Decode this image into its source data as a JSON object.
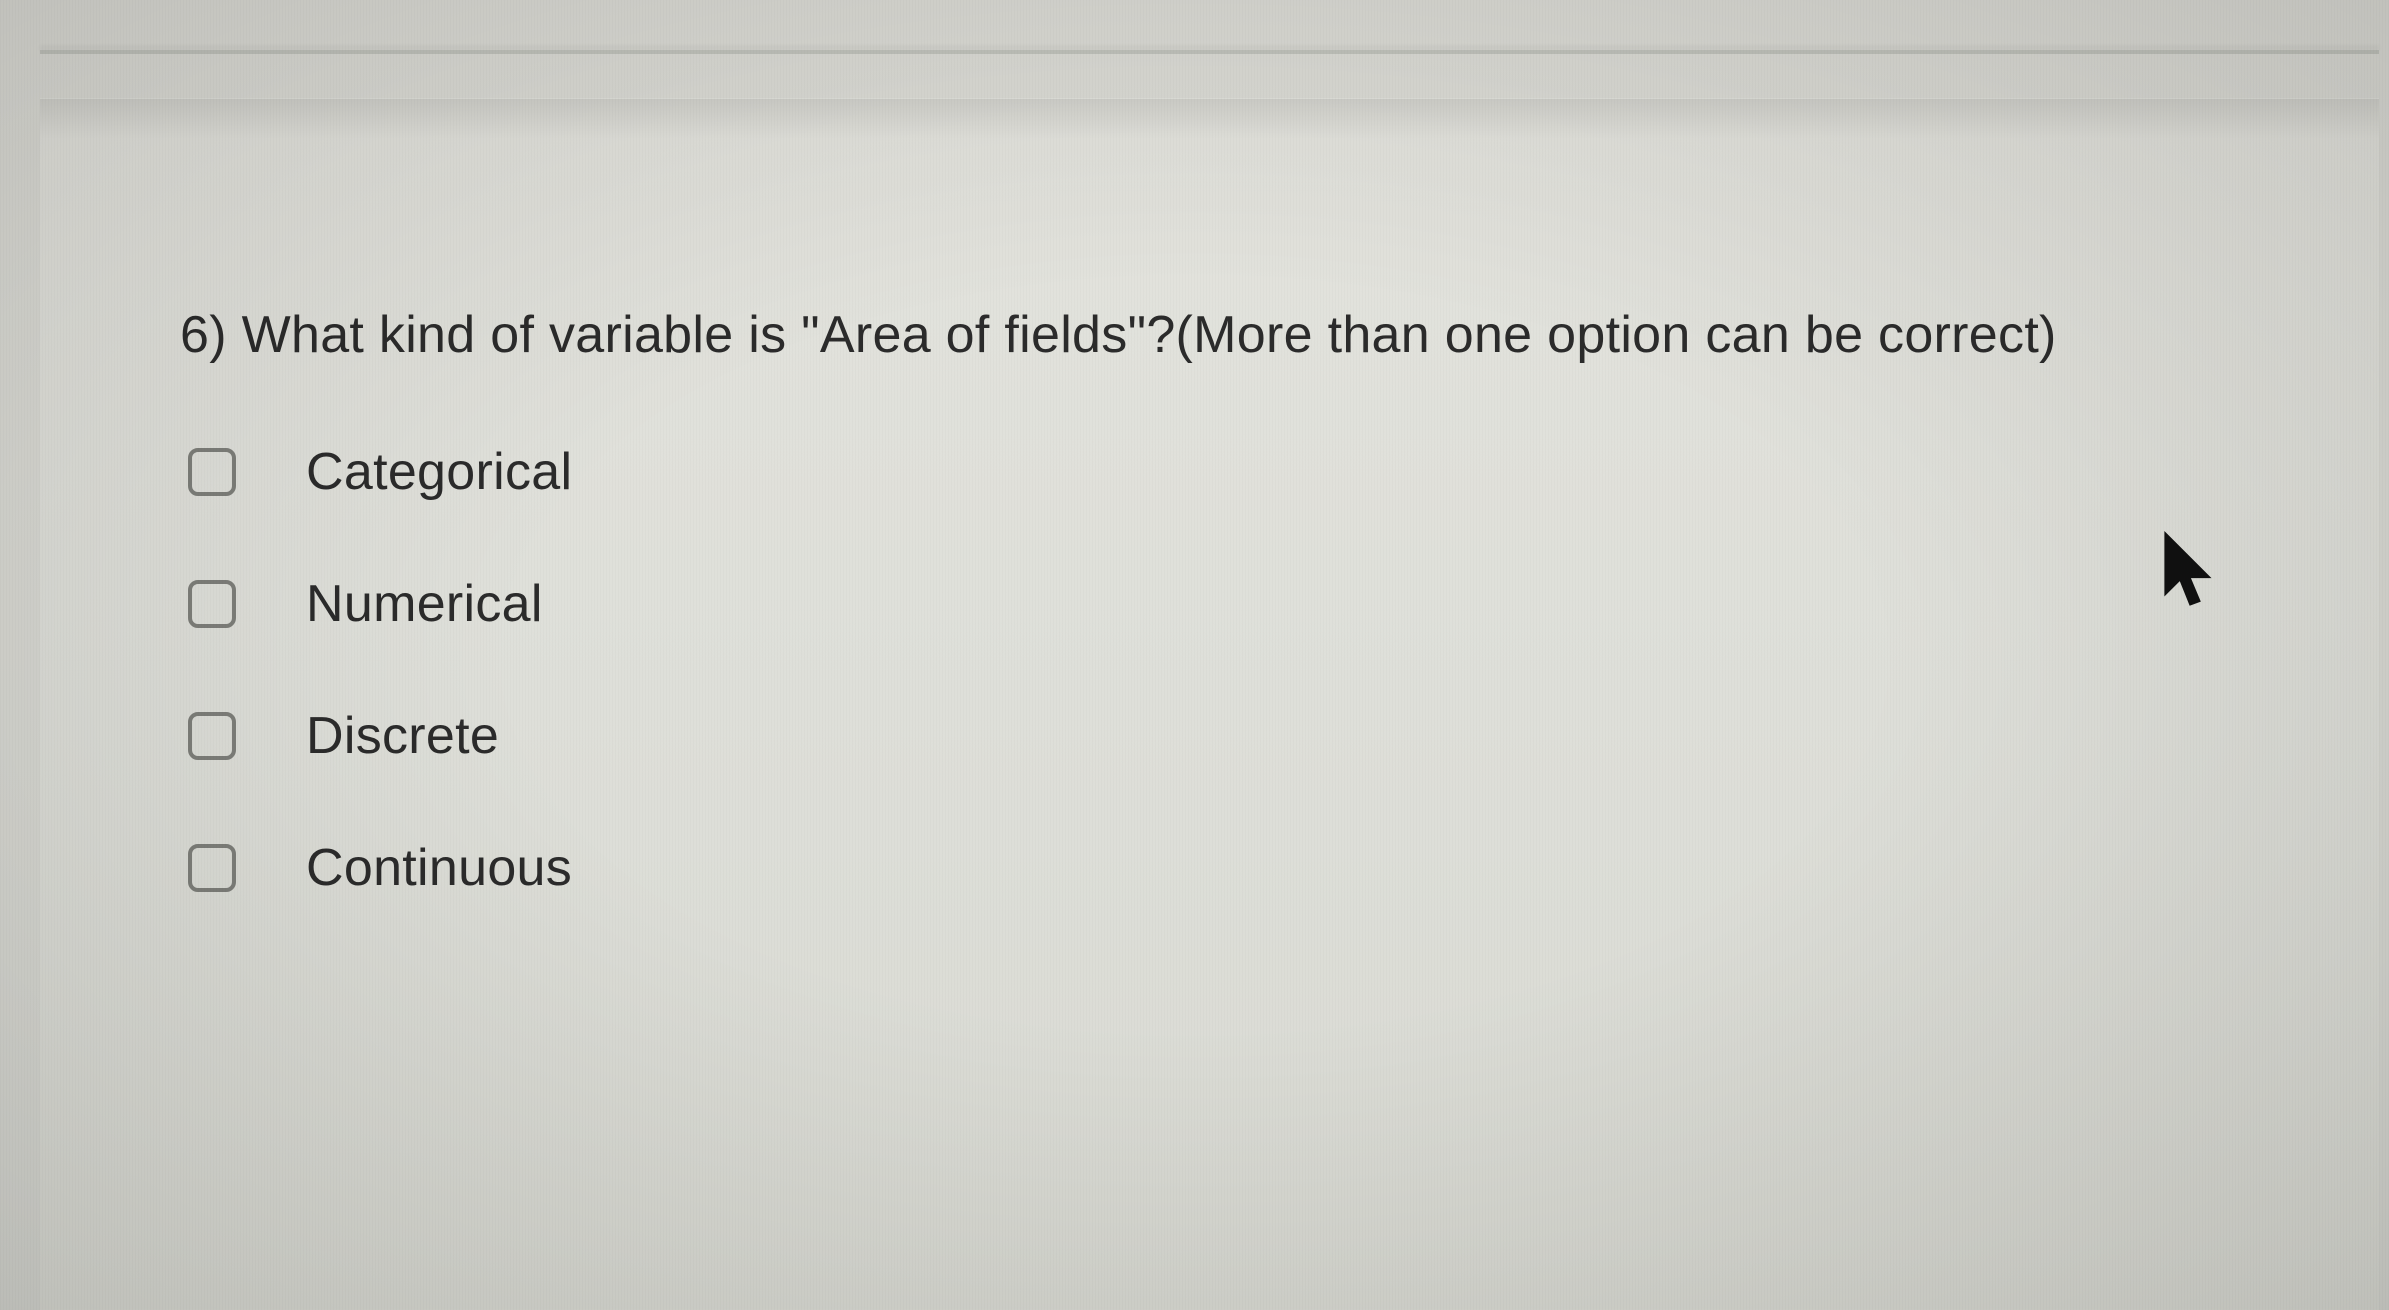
{
  "question": {
    "number": "6)",
    "text": "What kind of variable is \"Area of fields\"?(More than one option can be correct)"
  },
  "options": [
    {
      "label": "Categorical",
      "checked": false
    },
    {
      "label": "Numerical",
      "checked": false
    },
    {
      "label": "Discrete",
      "checked": false
    },
    {
      "label": "Continuous",
      "checked": false
    }
  ]
}
